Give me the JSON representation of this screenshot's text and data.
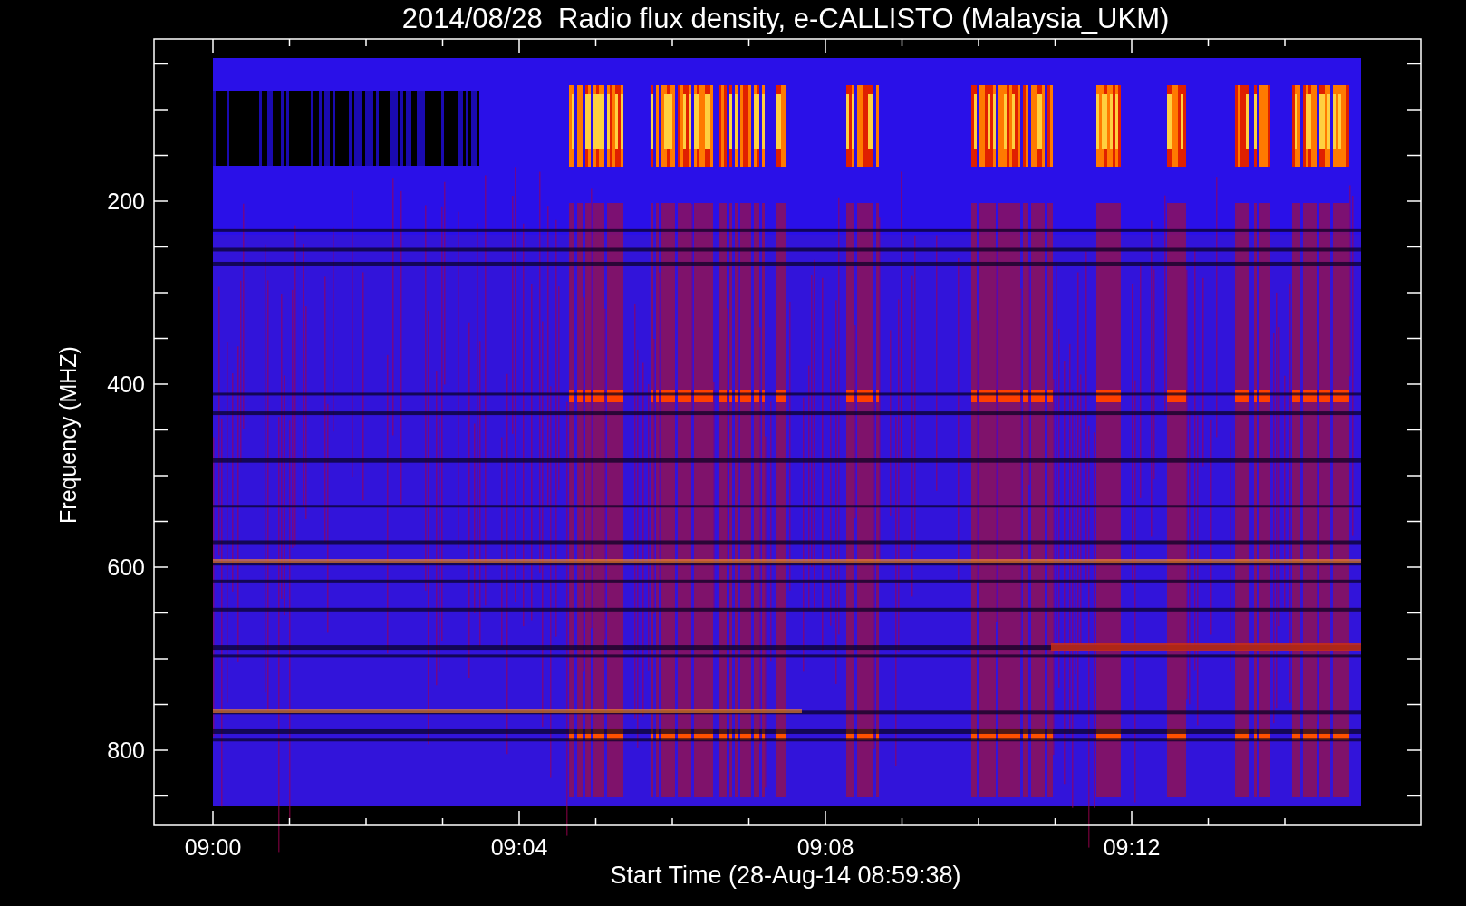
{
  "title": "2014/08/28  Radio flux density, e-CALLISTO (Malaysia_UKM)",
  "y_axis": {
    "label": "Frequency (MHZ)",
    "ticks": [
      "200",
      "400",
      "600",
      "800"
    ]
  },
  "x_axis": {
    "label": "Start Time (28-Aug-14 08:59:38)",
    "ticks": [
      "09:00",
      "09:04",
      "09:08",
      "09:12"
    ]
  }
}
